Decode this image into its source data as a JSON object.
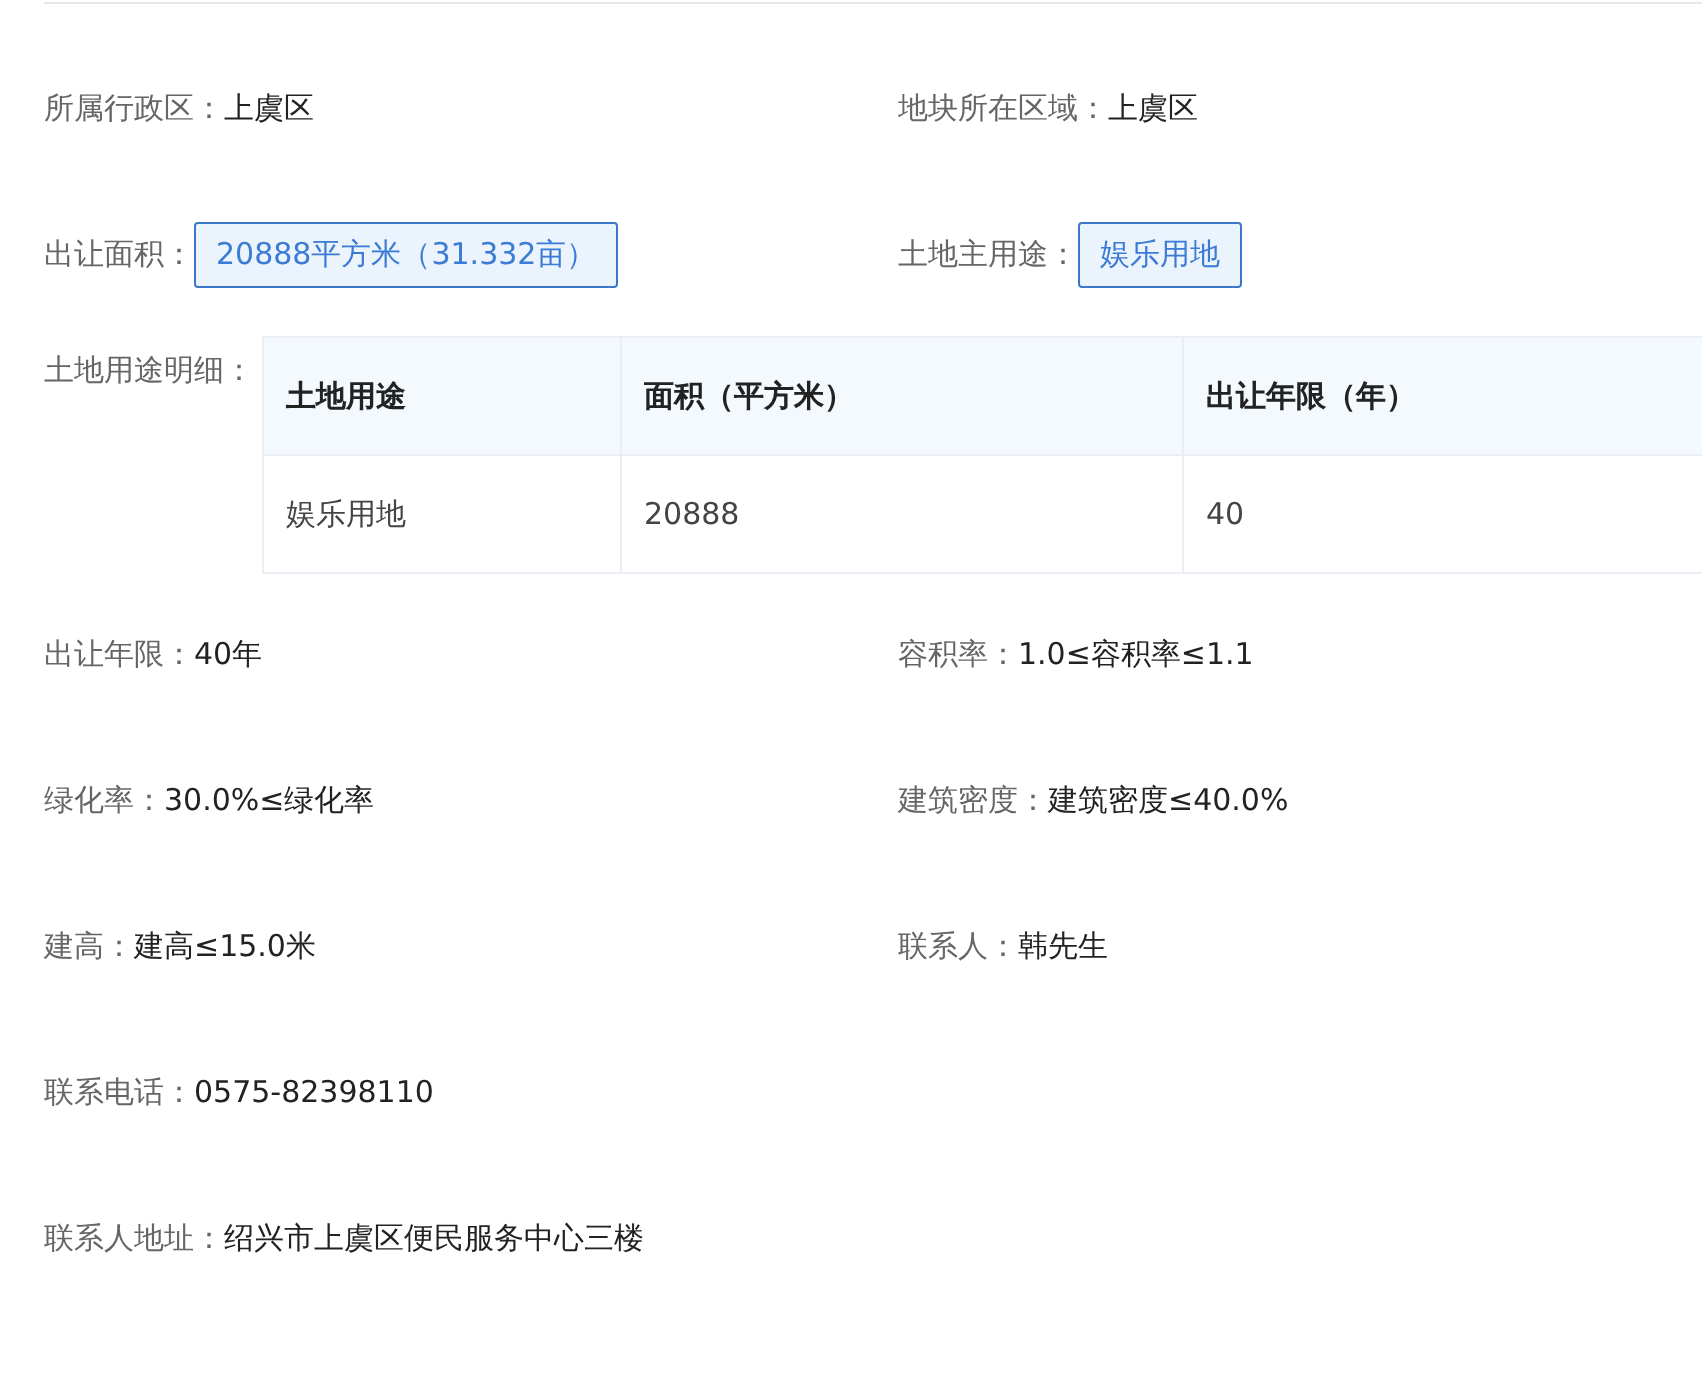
{
  "rows": [
    {
      "fields": [
        {
          "kind": "text",
          "label": "所属行政区：",
          "value": "上虞区"
        },
        {
          "kind": "text",
          "label": "地块所在区域：",
          "value": "上虞区"
        }
      ]
    },
    {
      "fields": [
        {
          "kind": "tag",
          "label": "出让面积：",
          "value": "20888平方米（31.332亩）"
        },
        {
          "kind": "tag",
          "label": "土地主用途：",
          "value": "娱乐用地"
        }
      ]
    },
    {
      "fields": [
        {
          "kind": "table",
          "label": "土地用途明细：",
          "columns": [
            "土地用途",
            "面积（平方米）",
            "出让年限（年）"
          ],
          "rows": [
            [
              "娱乐用地",
              "20888",
              "40"
            ]
          ]
        }
      ]
    },
    {
      "fields": [
        {
          "kind": "text",
          "label": "出让年限：",
          "value": "40年"
        },
        {
          "kind": "text",
          "label": "容积率：",
          "value": "1.0≤容积率≤1.1"
        }
      ]
    },
    {
      "fields": [
        {
          "kind": "text",
          "label": "绿化率：",
          "value": "30.0%≤绿化率"
        },
        {
          "kind": "text",
          "label": "建筑密度：",
          "value": "建筑密度≤40.0%"
        }
      ]
    },
    {
      "fields": [
        {
          "kind": "text",
          "label": "建高：",
          "value": "建高≤15.0米"
        },
        {
          "kind": "text",
          "label": "联系人：",
          "value": "韩先生"
        }
      ]
    },
    {
      "fields": [
        {
          "kind": "text",
          "label": "联系电话：",
          "value": "0575-82398110"
        }
      ]
    },
    {
      "fields": [
        {
          "kind": "text",
          "label": "联系人地址：",
          "value": "绍兴市上虞区便民服务中心三楼"
        }
      ]
    }
  ]
}
